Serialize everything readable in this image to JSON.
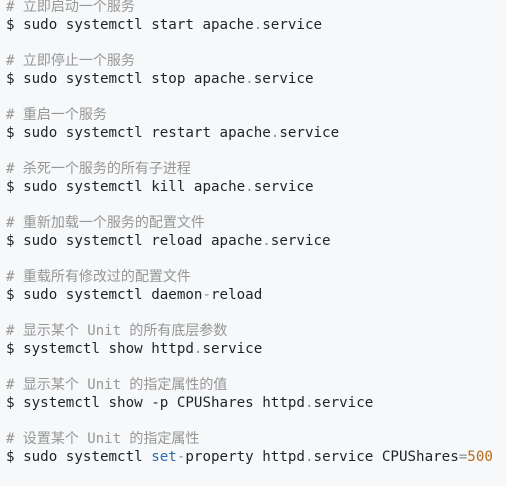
{
  "entries": [
    {
      "comment": "# 立即启动一个服务",
      "cmd_before": "$ sudo systemctl start apache",
      "dot": ".",
      "cmd_after": "service"
    },
    {
      "comment": "# 立即停止一个服务",
      "cmd_before": "$ sudo systemctl stop apache",
      "dot": ".",
      "cmd_after": "service"
    },
    {
      "comment": "# 重启一个服务",
      "cmd_before": "$ sudo systemctl restart apache",
      "dot": ".",
      "cmd_after": "service"
    },
    {
      "comment": "# 杀死一个服务的所有子进程",
      "cmd_before": "$ sudo systemctl kill apache",
      "dot": ".",
      "cmd_after": "service"
    },
    {
      "comment": "# 重新加载一个服务的配置文件",
      "cmd_before": "$ sudo systemctl reload apache",
      "dot": ".",
      "cmd_after": "service"
    },
    {
      "comment": "# 重载所有修改过的配置文件",
      "cmd_before": "$ sudo systemctl daemon",
      "dot": "-",
      "cmd_after": "reload"
    },
    {
      "comment": "# 显示某个 Unit 的所有底层参数",
      "cmd_before": "$ systemctl show httpd",
      "dot": ".",
      "cmd_after": "service"
    },
    {
      "comment": "# 显示某个 Unit 的指定属性的值",
      "cmd_before": "$ systemctl show -p CPUShares httpd",
      "dot": ".",
      "cmd_after": "service"
    }
  ],
  "last": {
    "comment": "# 设置某个 Unit 的指定属性",
    "cmd_prefix": "$ sudo systemctl ",
    "set_kw": "set",
    "dash": "-",
    "property": "property httpd",
    "dot": ".",
    "service": "service CPUShares",
    "equals": "=",
    "value": "500"
  }
}
